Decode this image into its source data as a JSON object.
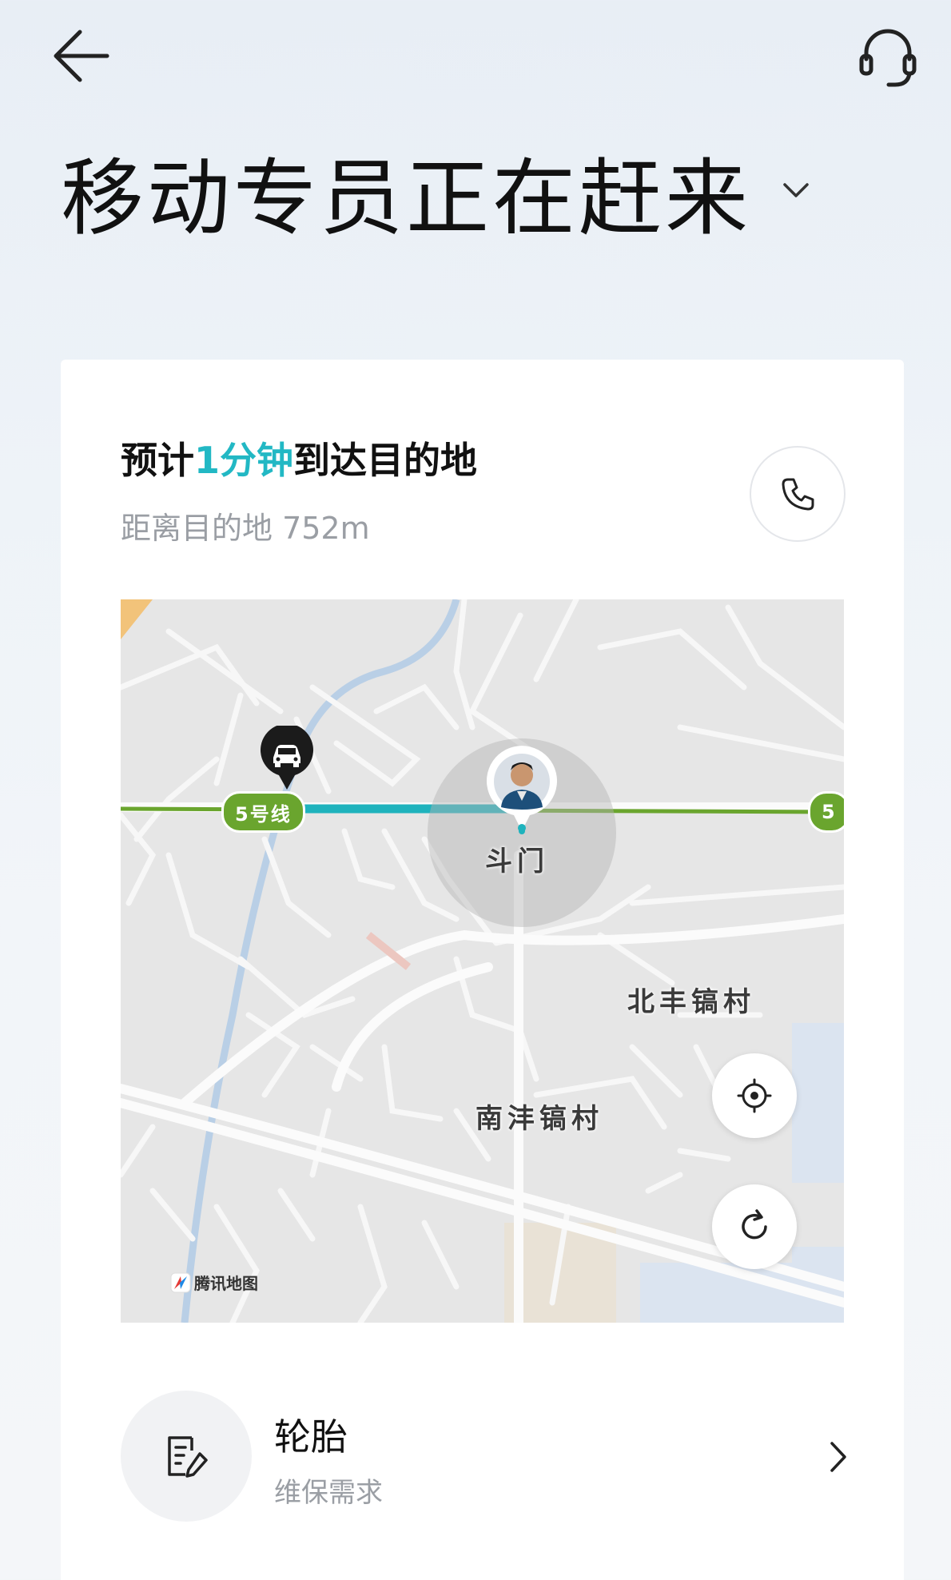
{
  "header": {
    "back_icon": "arrow-left-icon",
    "support_icon": "headset-icon",
    "title": "移动专员正在赶来",
    "title_chevron_icon": "chevron-down-icon"
  },
  "status_card": {
    "eta_prefix": "预计",
    "eta_highlight": "1分钟",
    "eta_suffix": "到达目的地",
    "distance": "距离目的地 752m",
    "call_icon": "phone-icon",
    "accent_color": "#22b8c4"
  },
  "map": {
    "labels": {
      "station": "斗门",
      "village_north": "北丰镐村",
      "village_south": "南沣镐村"
    },
    "metro_line_badge": "5号线",
    "metro_line_badge_partial": "5",
    "attribution": "腾讯地图",
    "buttons": {
      "locate_icon": "crosshair-icon",
      "refresh_icon": "refresh-icon"
    },
    "markers": {
      "vehicle_icon": "car-pin-icon",
      "agent_avatar": "avatar"
    },
    "route_color": "#1fb3bd",
    "metro_color": "#6aa52e"
  },
  "service": {
    "title": "轮胎",
    "subtitle": "维保需求",
    "icon": "edit-form-icon",
    "chevron_icon": "chevron-right-icon"
  }
}
